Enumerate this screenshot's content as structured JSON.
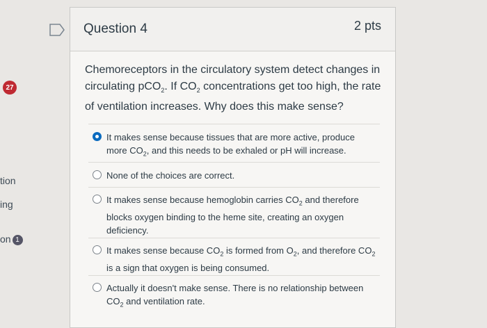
{
  "sidebar": {
    "badge_count": "27",
    "item1": "tion",
    "item2": "ing",
    "item3": "on",
    "item3_badge": "1"
  },
  "question": {
    "title": "Question 4",
    "points": "2 pts",
    "text_part1": "Chemoreceptors in the circulatory system detect changes in circulating pCO",
    "text_part2": ". If CO",
    "text_part3": " concentrations get too high, the rate of ventilation increases. Why does this make sense?",
    "subscript": "2"
  },
  "answers": [
    {
      "selected": true,
      "parts": [
        "It makes sense because tissues that are more active, produce more CO",
        ", and this needs to be exhaled or pH will increase."
      ]
    },
    {
      "selected": false,
      "parts": [
        "None of the choices are correct."
      ]
    },
    {
      "selected": false,
      "parts": [
        "It makes sense because hemoglobin carries CO",
        " and therefore blocks oxygen binding to the heme site, creating an oxygen deficiency."
      ]
    },
    {
      "selected": false,
      "parts": [
        "It makes sense because CO",
        " is formed from O",
        ", and therefore CO",
        " is a sign that oxygen is being consumed."
      ]
    },
    {
      "selected": false,
      "parts": [
        "Actually it doesn't make sense. There is no relationship between CO",
        " and ventilation rate."
      ]
    }
  ]
}
